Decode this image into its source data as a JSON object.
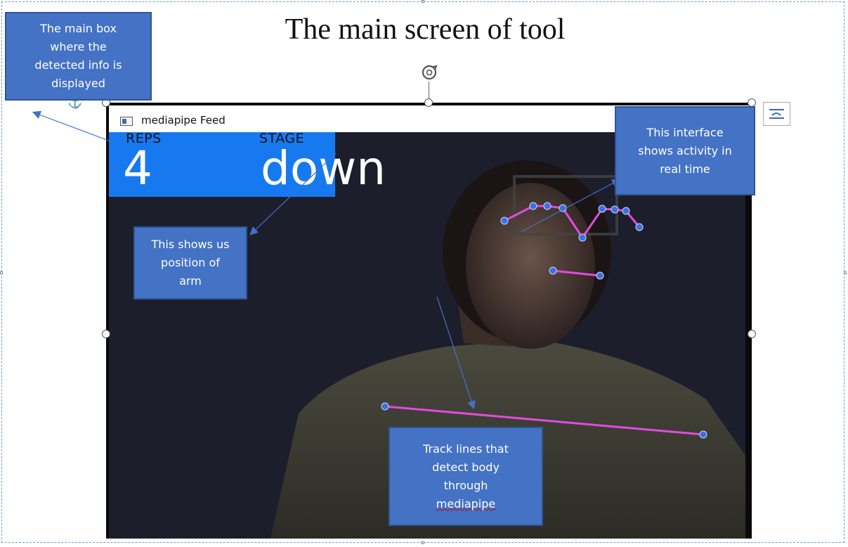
{
  "page_title": "The main screen of tool",
  "window": {
    "title": "mediapipe Feed"
  },
  "hud": {
    "reps_label": "REPS",
    "reps_value": "4",
    "stage_label": "STAGE",
    "stage_value": "down",
    "background_color": "#1779ef"
  },
  "callouts": {
    "main_box": [
      "The main box",
      "where the",
      "detected info is",
      "displayed"
    ],
    "interface": [
      "This interface",
      "shows activity in",
      "real time"
    ],
    "arm_position": [
      "This shows us",
      "position of",
      "arm"
    ],
    "track_lines": [
      "Track lines that",
      "detect body",
      "through",
      "mediapipe"
    ]
  },
  "colors": {
    "callout_fill": "#4472c4",
    "landmark_line": "#e04be0",
    "landmark_point": "#3d6fe0"
  },
  "icons": {
    "rotate": "rotate-handle-icon",
    "anchor": "anchor-icon",
    "layout_options": "layout-options-icon",
    "window_app": "window-app-icon"
  }
}
